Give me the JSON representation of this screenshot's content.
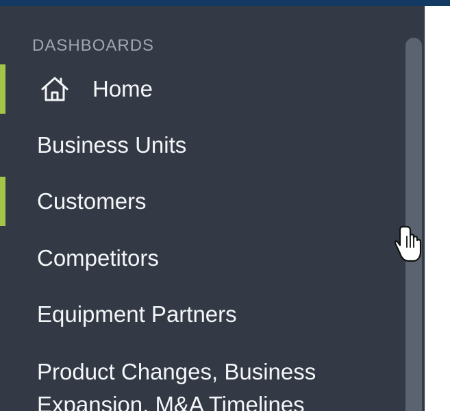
{
  "sidebar": {
    "section_header": "DASHBOARDS",
    "items": [
      {
        "label": "Home",
        "icon": "home-icon"
      },
      {
        "label": "Business Units"
      },
      {
        "label": "Customers"
      },
      {
        "label": "Competitors"
      },
      {
        "label": "Equipment Partners"
      },
      {
        "label": "Product Changes, Business Expansion, M&A Timelines"
      }
    ]
  },
  "colors": {
    "sidebar_bg": "#333a45",
    "accent": "#a5c548",
    "topbar": "#123a63"
  }
}
